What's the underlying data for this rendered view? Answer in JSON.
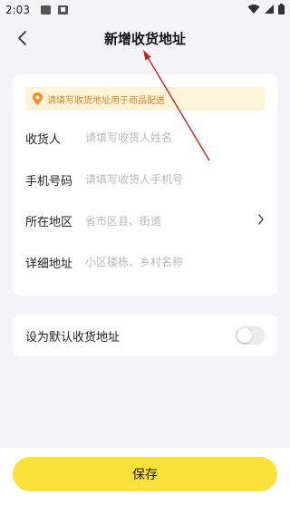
{
  "status_bar": {
    "time": "2:03",
    "icons": [
      "gallery-notification-icon",
      "a-notification-icon",
      "wifi-icon",
      "signal-icon",
      "battery-icon"
    ]
  },
  "nav": {
    "title": "新增收货地址",
    "back_icon": "chevron-left-icon"
  },
  "form": {
    "notice": {
      "icon": "location-pin-icon",
      "text": "请填写收货地址用于商品配送"
    },
    "fields": [
      {
        "label": "收货人",
        "placeholder": "请填写收货人姓名"
      },
      {
        "label": "手机号码",
        "placeholder": "请填写收货人手机号"
      },
      {
        "label": "所在地区",
        "placeholder": "省市区县、街道",
        "icon": "chevron-right-icon"
      },
      {
        "label": "详细地址",
        "placeholder": "小区楼栋、乡村名称"
      }
    ]
  },
  "default_address": {
    "label": "设为默认收货地址",
    "enabled": false
  },
  "footer": {
    "save_label": "保存"
  },
  "colors": {
    "accent_yellow": "#fbe23a",
    "notice_bg": "#fdf3d9",
    "notice_text": "#d08a2a",
    "pin_orange": "#f08c2a",
    "annotation_red": "#c8201e",
    "page_bg": "#f4f4f8"
  }
}
